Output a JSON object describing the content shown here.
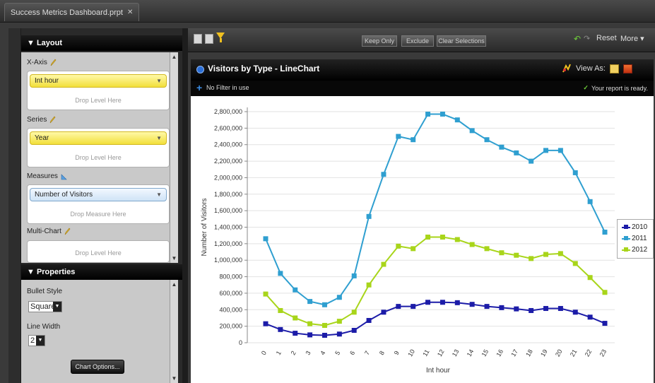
{
  "document_tab": {
    "title": "Success Metrics Dashboard.prpt",
    "close_icon": "close-icon"
  },
  "layout_panel": {
    "header": "▼ Layout",
    "xaxis": {
      "label": "X-Axis",
      "value": "Int hour",
      "drop_hint": "Drop Level Here"
    },
    "series": {
      "label": "Series",
      "value": "Year",
      "drop_hint": "Drop Level Here"
    },
    "measures": {
      "label": "Measures",
      "value": "Number of Visitors",
      "drop_hint": "Drop Measure Here"
    },
    "multichart": {
      "label": "Multi-Chart",
      "drop_hint": "Drop Level Here"
    }
  },
  "properties_panel": {
    "header": "▼ Properties",
    "bullet_style": {
      "label": "Bullet Style",
      "value": "Square"
    },
    "line_width": {
      "label": "Line Width",
      "value": "2"
    },
    "chart_options": "Chart Options..."
  },
  "toolbar": {
    "keep_only": "Keep Only",
    "exclude": "Exclude",
    "clear_selections": "Clear Selections",
    "reset": "Reset",
    "more": "More ▾"
  },
  "chart_header": {
    "title": "Visitors by Type - LineChart",
    "view_as": "View As:",
    "filter_text": "No Filter in use",
    "ready_text": "Your report is ready."
  },
  "colors": {
    "s2010": "#1c1ca8",
    "s2011": "#2f9fd0",
    "s2012": "#a8d51a"
  },
  "chart_data": {
    "type": "line",
    "xlabel": "Int hour",
    "ylabel": "Number of Visitors",
    "ylim": [
      0,
      2800000
    ],
    "yticks": [
      "0",
      "200,000",
      "400,000",
      "600,000",
      "800,000",
      "1,000,000",
      "1,200,000",
      "1,400,000",
      "1,600,000",
      "1,800,000",
      "2,000,000",
      "2,200,000",
      "2,400,000",
      "2,600,000",
      "2,800,000"
    ],
    "x": [
      "0",
      "1",
      "2",
      "3",
      "4",
      "5",
      "6",
      "7",
      "8",
      "9",
      "10",
      "11",
      "12",
      "13",
      "14",
      "15",
      "16",
      "17",
      "18",
      "19",
      "20",
      "21",
      "22",
      "23"
    ],
    "legend_position": "right",
    "series": [
      {
        "name": "2010",
        "values": [
          230000,
          160000,
          115000,
          95000,
          90000,
          105000,
          150000,
          270000,
          370000,
          440000,
          440000,
          490000,
          490000,
          485000,
          465000,
          440000,
          425000,
          410000,
          390000,
          415000,
          415000,
          370000,
          310000,
          235000
        ]
      },
      {
        "name": "2011",
        "values": [
          1260000,
          840000,
          640000,
          500000,
          460000,
          550000,
          810000,
          1530000,
          2040000,
          2500000,
          2460000,
          2770000,
          2770000,
          2700000,
          2570000,
          2460000,
          2370000,
          2300000,
          2200000,
          2330000,
          2330000,
          2060000,
          1710000,
          1340000
        ]
      },
      {
        "name": "2012",
        "values": [
          590000,
          390000,
          300000,
          230000,
          210000,
          260000,
          370000,
          700000,
          950000,
          1170000,
          1140000,
          1280000,
          1280000,
          1250000,
          1190000,
          1140000,
          1090000,
          1060000,
          1020000,
          1070000,
          1080000,
          960000,
          790000,
          610000
        ]
      }
    ]
  }
}
